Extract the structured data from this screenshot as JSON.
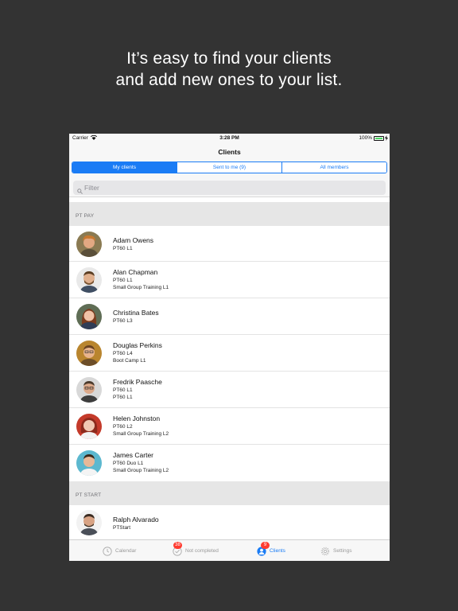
{
  "promo": {
    "line1": "It’s easy to find your clients",
    "line2": "and add new ones to your list."
  },
  "statusbar": {
    "carrier": "Carrier",
    "time": "3:28 PM",
    "battery": "100%"
  },
  "navbar": {
    "title": "Clients"
  },
  "segments": [
    {
      "label": "My clients",
      "active": true
    },
    {
      "label": "Sent to me (9)",
      "active": false
    },
    {
      "label": "All members",
      "active": false
    }
  ],
  "search": {
    "placeholder": "Filter",
    "value": ""
  },
  "sections": [
    {
      "title": "PT PAY",
      "clients": [
        {
          "name": "Adam Owens",
          "details": [
            "PT60 L1"
          ]
        },
        {
          "name": "Alan Chapman",
          "details": [
            "PT60 L1",
            "Small Group Training L1"
          ]
        },
        {
          "name": "Christina Bates",
          "details": [
            "PT60 L3"
          ]
        },
        {
          "name": "Douglas Perkins",
          "details": [
            "PT60 L4",
            "Boot Camp L1"
          ]
        },
        {
          "name": "Fredrik Paasche",
          "details": [
            "PT60 L1",
            "PT60 L1"
          ]
        },
        {
          "name": "Helen Johnston",
          "details": [
            "PT60 L2",
            "Small Group Training L2"
          ]
        },
        {
          "name": "James Carter",
          "details": [
            "PT60 Duo L1",
            "Small Group Training L2"
          ]
        }
      ]
    },
    {
      "title": "PT START",
      "clients": [
        {
          "name": "Ralph Alvarado",
          "details": [
            "PTStart"
          ]
        }
      ]
    }
  ],
  "tabbar": {
    "calendar": {
      "label": "Calendar",
      "icon": "clock-icon"
    },
    "not_completed": {
      "label": "Not completed",
      "icon": "check-circle-icon",
      "badge": "38"
    },
    "clients": {
      "label": "Clients",
      "icon": "person-icon",
      "badge": "9"
    },
    "settings": {
      "label": "Settings",
      "icon": "gear-icon"
    }
  },
  "colors": {
    "accent": "#1a7cf5",
    "badge": "#ff3b30",
    "background": "#333333",
    "battery": "#4cd964"
  }
}
